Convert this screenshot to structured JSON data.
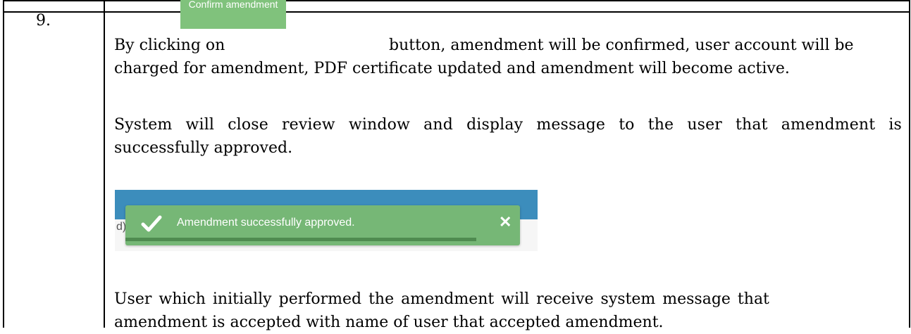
{
  "row": {
    "number": "9."
  },
  "paragraph1": {
    "prefix": "By clicking on",
    "button_label": "Confirm amendment",
    "line1_rest": "button, amendment will be confirmed, user account will be",
    "line2": "charged for amendment, PDF certificate updated and amendment will become active."
  },
  "paragraph2": {
    "line1": "System will close review window and display message to the user that amendment is",
    "line2": "successfully approved."
  },
  "notification": {
    "message": "Amendment successfully approved.",
    "close_symbol": "✕",
    "background_peek": "d)",
    "progress_fraction": 0.89,
    "colors": {
      "toast": "#76b776",
      "progress": "#4f8b50",
      "header": "#3c8dbc"
    }
  },
  "paragraph3": {
    "line1": "User which initially performed the amendment will receive system message that",
    "line2": "amendment is accepted with name of user that accepted amendment."
  }
}
